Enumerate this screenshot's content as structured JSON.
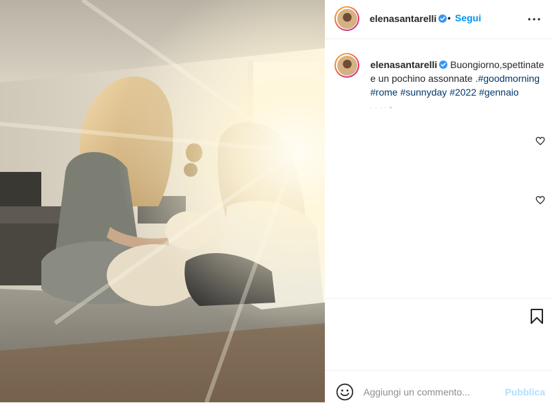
{
  "post": {
    "image_alt": "",
    "author": {
      "username": "elenasantarelli",
      "verified": true
    },
    "header": {
      "separator": "•",
      "follow_label": "Segui",
      "more_icon": "more-options-icon"
    },
    "caption": {
      "username": "elenasantarelli",
      "text": "Buongiorno,spettinate e un pochino assonnate .",
      "hashtags": [
        "#goodmorning",
        "#rome",
        "#sunnyday",
        "#2022",
        "#gennaio"
      ],
      "timestamp": "· · · · +"
    },
    "actions": {
      "like_icon": "heart-icon",
      "save_icon": "bookmark-icon"
    },
    "add_comment": {
      "emoji_icon": "emoji-icon",
      "placeholder": "Aggiungi un commento...",
      "publish_label": "Pubblica"
    }
  },
  "colors": {
    "link": "#0095f6",
    "hashtag": "#00376b",
    "publish_disabled": "#b2dffc",
    "text": "#262626"
  }
}
